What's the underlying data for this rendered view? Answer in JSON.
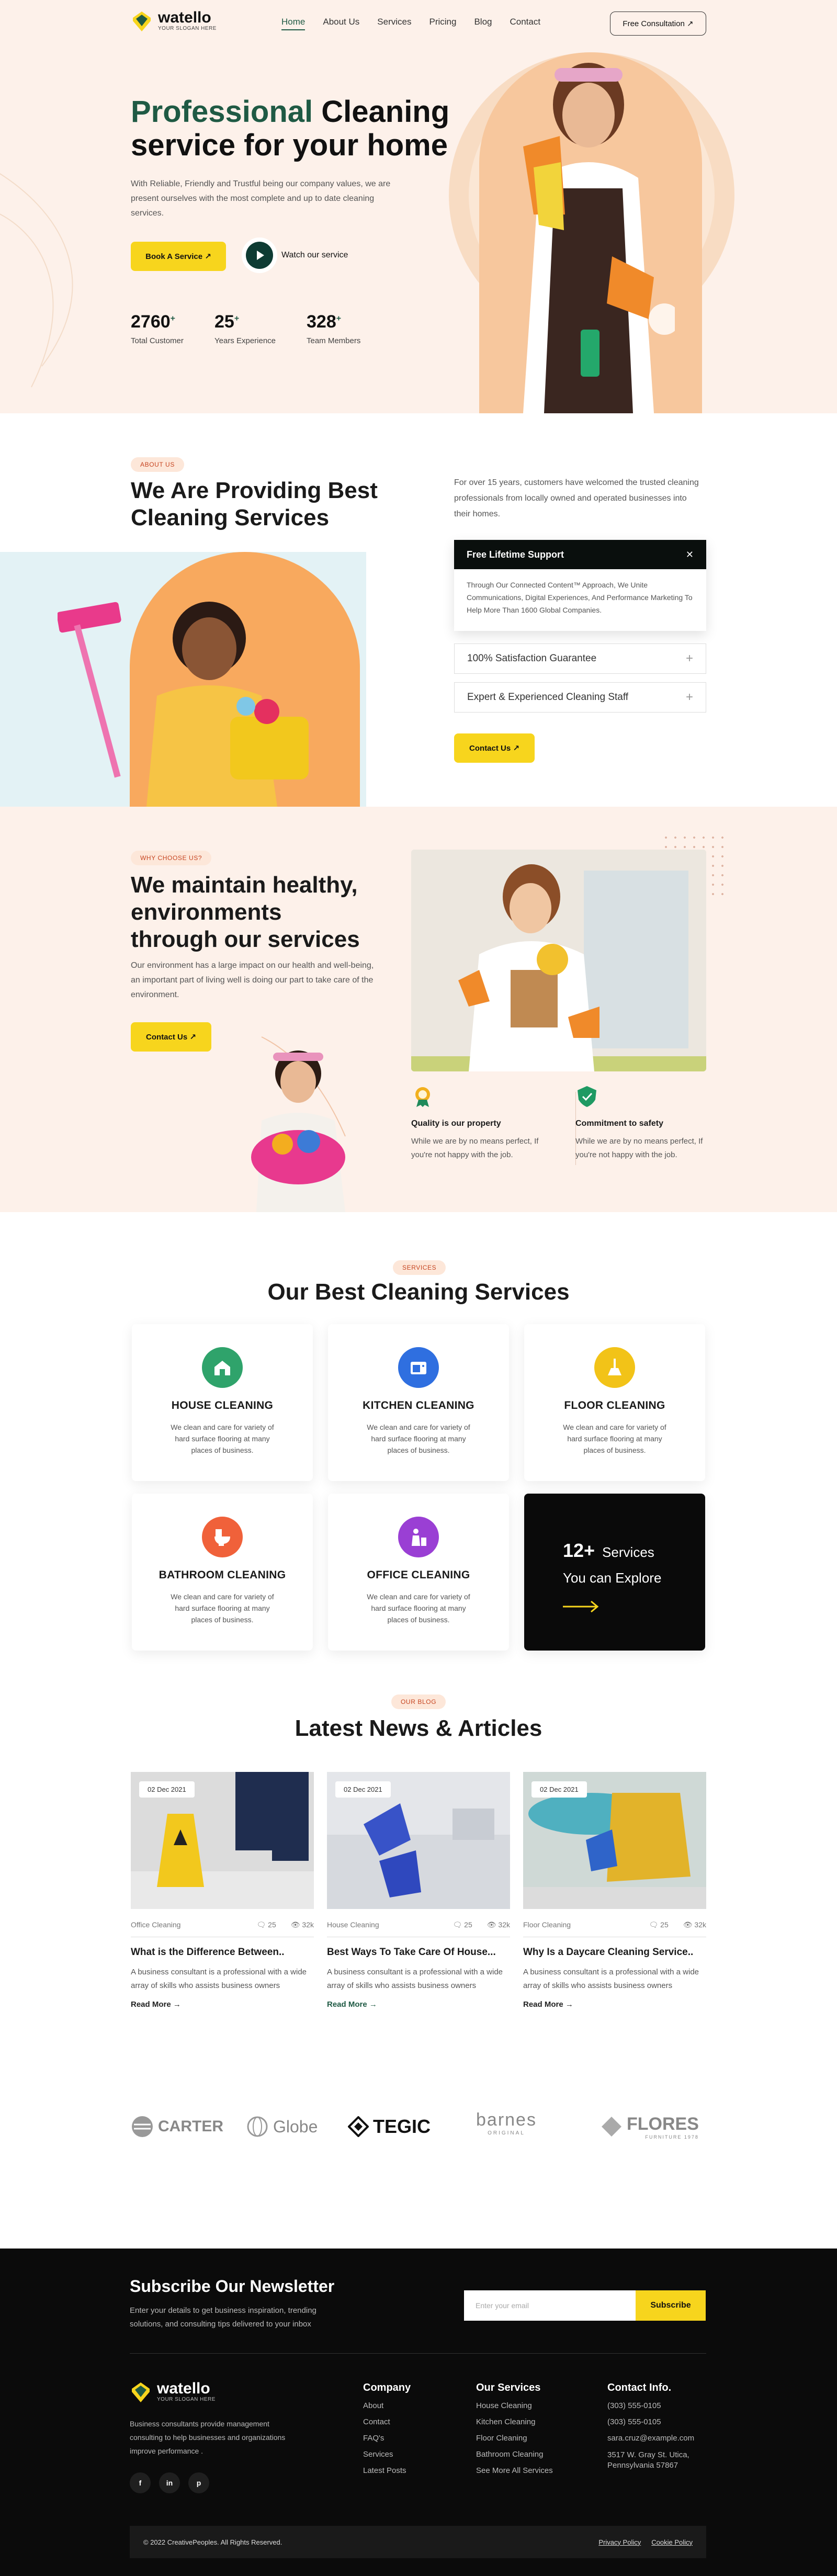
{
  "brand": {
    "name": "watello",
    "tagline": "YOUR SLOGAN HERE"
  },
  "nav": {
    "items": [
      "Home",
      "About Us",
      "Services",
      "Pricing",
      "Blog",
      "Contact"
    ],
    "active": "Home",
    "cta": "Free Consultation ↗"
  },
  "hero": {
    "title_green": "Professional",
    "title_rest": "Cleaning service for your home",
    "lead": "With Reliable, Friendly and Trustful being our company values, we are present ourselves with the most complete and up to date cleaning services.",
    "book": "Book A Service ↗",
    "watch": "Watch our service",
    "stats": [
      {
        "num": "2760",
        "plus": "+",
        "label": "Total Customer"
      },
      {
        "num": "25",
        "plus": "+",
        "label": "Years Experience"
      },
      {
        "num": "328",
        "plus": "+",
        "label": "Team Members"
      }
    ]
  },
  "about": {
    "tag": "ABOUT US",
    "title": "We Are Providing Best Cleaning Services",
    "text": "For over 15 years, customers have welcomed the trusted cleaning professionals from locally owned and operated businesses into their homes.",
    "accordion": [
      {
        "title": "Free Lifetime Support",
        "body": "Through Our Connected Content™ Approach, We Unite Communications, Digital Experiences, And Performance Marketing To Help More Than 1600 Global Companies.",
        "open": true
      },
      {
        "title": "100% Satisfaction Guarantee",
        "open": false
      },
      {
        "title": "Expert & Experienced Cleaning Staff",
        "open": false
      }
    ],
    "contact": "Contact Us ↗"
  },
  "why": {
    "tag": "WHY CHOOSE US?",
    "title": "We maintain healthy, environments through our services",
    "text": "Our environment has a large impact on our health and well-being, an important part of living well is doing our part to take care of the environment.",
    "contact": "Contact Us ↗",
    "features": [
      {
        "title": "Quality is our property",
        "text": "While we are by no means perfect, If you're not happy with the job.",
        "icon": "award-icon"
      },
      {
        "title": "Commitment to safety",
        "text": "While we are by no means perfect, If you're not happy with the job.",
        "icon": "shield-check-icon"
      }
    ]
  },
  "services": {
    "tag": "SERVICES",
    "title": "Our Best Cleaning Services",
    "items": [
      {
        "title": "HOUSE CLEANING",
        "text": "We clean and care for variety of hard surface flooring at many places of business.",
        "color": "#2fa36b",
        "icon": "house-cleaning-icon"
      },
      {
        "title": "KITCHEN CLEANING",
        "text": "We clean and care for variety of hard surface flooring at many places of business.",
        "color": "#2f6fe0",
        "icon": "kitchen-icon"
      },
      {
        "title": "FLOOR CLEANING",
        "text": "We clean and care for variety of hard surface flooring at many places of business.",
        "color": "#f2c318",
        "icon": "floor-icon"
      },
      {
        "title": "BATHROOM CLEANING",
        "text": "We clean and care for variety of hard surface flooring at many places of business.",
        "color": "#f0613a",
        "icon": "toilet-icon"
      },
      {
        "title": "OFFICE CLEANING",
        "text": "We clean and care for variety of hard surface flooring at many places of business.",
        "color": "#9a3fd4",
        "icon": "office-icon"
      }
    ],
    "more": {
      "count": "12+",
      "count_label": "Services",
      "sub": "You can Explore"
    }
  },
  "blog": {
    "tag": "OUR BLOG",
    "title": "Latest News & Articles",
    "posts": [
      {
        "date": "02 Dec 2021",
        "cat": "Office Cleaning",
        "comments": "25",
        "views": "32k",
        "title": "What is the Difference Between..",
        "text": "A business consultant is a professional with a wide array of skills who assists business owners",
        "more": "Read More →"
      },
      {
        "date": "02 Dec 2021",
        "cat": "House Cleaning",
        "comments": "25",
        "views": "32k",
        "title": "Best Ways To Take Care Of House...",
        "text": "A business consultant is a professional with a wide array of skills who assists business owners",
        "more": "Read More →"
      },
      {
        "date": "02 Dec 2021",
        "cat": "Floor Cleaning",
        "comments": "25",
        "views": "32k",
        "title": "Why Is a Daycare Cleaning Service..",
        "text": "A business consultant is a professional with a wide array of skills who assists business owners",
        "more": "Read More →"
      }
    ]
  },
  "partners": [
    "CARTER",
    "Globe",
    "TEGIC",
    "barnes",
    "FLORES"
  ],
  "partner_subs": {
    "barnes": "ORIGINAL",
    "flores": "FURNITURE 1978"
  },
  "newsletter": {
    "title": "Subscribe Our Newsletter",
    "text": "Enter your details to get business inspiration, trending solutions, and consulting tips delivered to your inbox",
    "placeholder": "Enter your email",
    "button": "Subscribe"
  },
  "footer": {
    "desc": "Business consultants provide management consulting to help businesses and organizations improve performance .",
    "company": {
      "title": "Company",
      "items": [
        "About",
        "Contact",
        "FAQ's",
        "Services",
        "Latest Posts"
      ]
    },
    "services": {
      "title": "Our Services",
      "items": [
        "House Cleaning",
        "Kitchen Cleaning",
        "Floor Cleaning",
        "Bathroom Cleaning",
        "See More All Services"
      ]
    },
    "contact": {
      "title": "Contact Info.",
      "items": [
        "(303) 555-0105",
        "(303) 555-0105",
        "sara.cruz@example.com",
        "3517 W. Gray St. Utica, Pennsylvania 57867"
      ]
    },
    "copyright": "© 2022 CreativePeoples. All Rights Reserved.",
    "links": [
      "Privacy Policy",
      "Cookie Policy"
    ],
    "socials": [
      "f",
      "in",
      "p"
    ]
  }
}
